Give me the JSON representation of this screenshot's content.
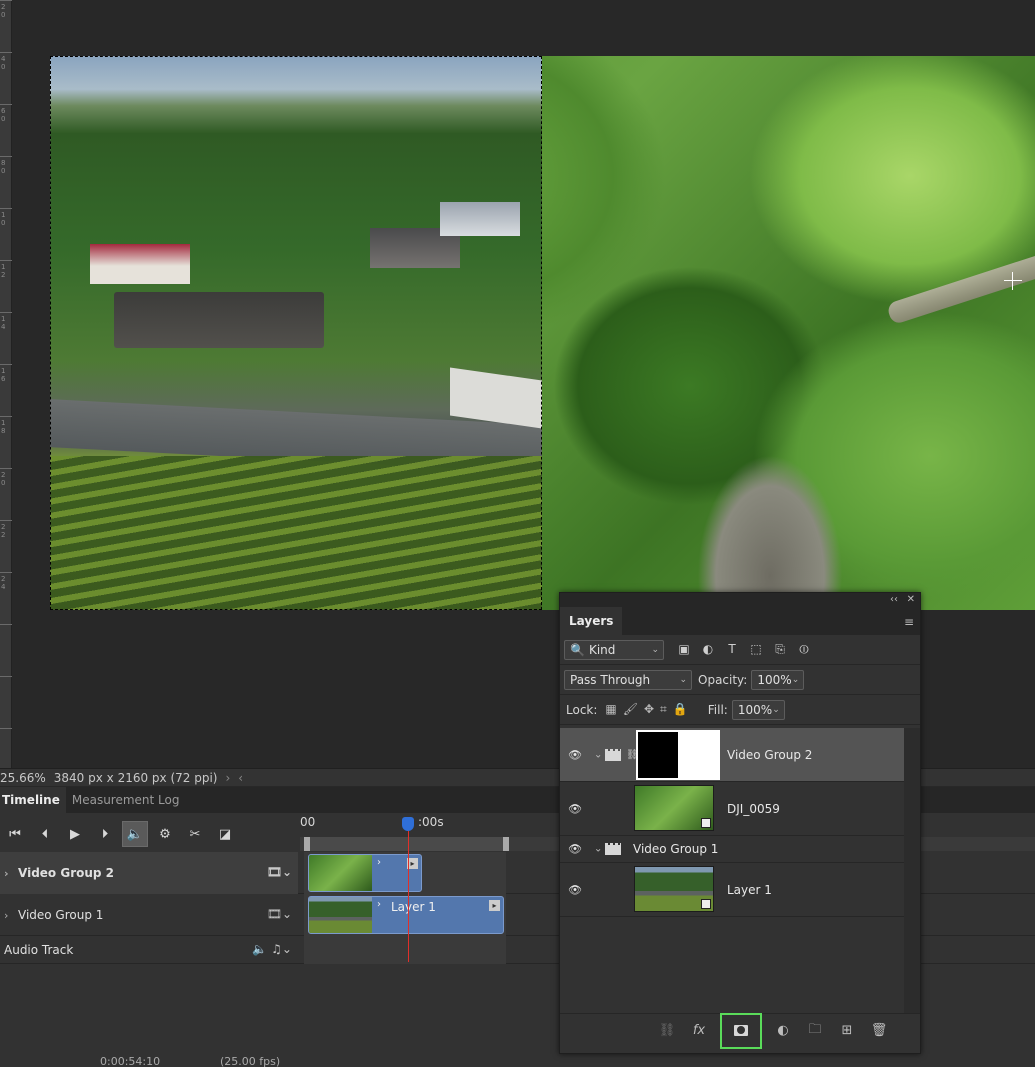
{
  "ruler": {
    "ticks": [
      "2",
      "0",
      "4",
      "0",
      "6",
      "0",
      "8",
      "0",
      "1",
      "0",
      "1",
      "2",
      "1",
      "4",
      "1",
      "6",
      "1",
      "8",
      "2",
      "0",
      "2",
      "2",
      "2",
      "4"
    ]
  },
  "status_bar": {
    "zoom": "25.66%",
    "doc_info": "3840 px x 2160 px (72 ppi)",
    "arrow": "›",
    "back": "‹"
  },
  "timeline": {
    "tabs": [
      "Timeline",
      "Measurement Log"
    ],
    "ruler_start": "00",
    "ruler_mark": ":00s",
    "tracks": [
      {
        "name": "Video Group 2",
        "clip_label": ""
      },
      {
        "name": "Video Group 1",
        "clip_label": "Layer 1"
      },
      {
        "name": "Audio Track"
      }
    ],
    "bottom_timecode": "0:00:54:10",
    "bottom_fps": "(25.00 fps)"
  },
  "layers": {
    "title": "Layers",
    "filter_kind": "Kind",
    "blend_mode": "Pass Through",
    "opacity_label": "Opacity:",
    "opacity_value": "100%",
    "lock_label": "Lock:",
    "fill_label": "Fill:",
    "fill_value": "100%",
    "items": [
      {
        "name": "Video Group 2",
        "type": "group",
        "selected": true
      },
      {
        "name": "DJI_0059",
        "type": "video"
      },
      {
        "name": "Video Group 1",
        "type": "group"
      },
      {
        "name": "Layer 1",
        "type": "video"
      }
    ],
    "footer_icons": [
      "link-icon",
      "fx-icon",
      "add-mask-icon",
      "adjustment-icon",
      "new-group-icon",
      "new-layer-icon",
      "delete-icon"
    ]
  }
}
